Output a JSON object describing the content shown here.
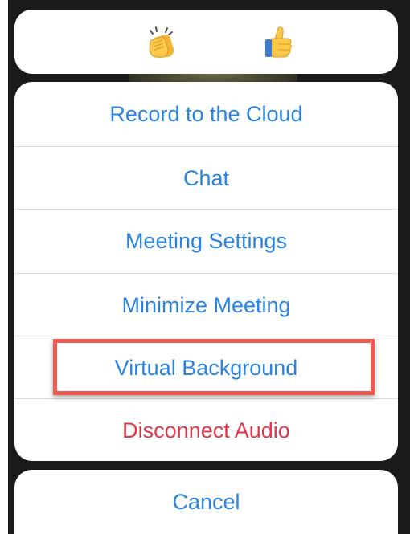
{
  "reactions": [
    {
      "icon": "clapping-hands-icon"
    },
    {
      "icon": "thumbs-up-icon"
    }
  ],
  "menu": {
    "items": [
      {
        "label": "Record to the Cloud"
      },
      {
        "label": "Chat"
      },
      {
        "label": "Meeting Settings"
      },
      {
        "label": "Minimize Meeting"
      },
      {
        "label": "Virtual Background",
        "highlighted": true
      },
      {
        "label": "Disconnect Audio",
        "destructive": true
      }
    ]
  },
  "cancel": {
    "label": "Cancel"
  },
  "colors": {
    "action_blue": "#2b83e0",
    "destructive_red": "#e0374a",
    "highlight_red": "#ef5a4e"
  }
}
